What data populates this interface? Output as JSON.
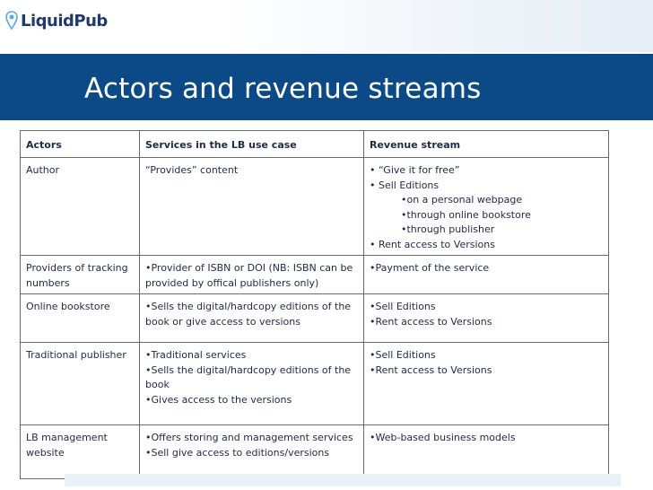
{
  "brand": {
    "name": "LiquidPub",
    "logo_icon": "location-pin-icon",
    "accent": "#0b4a86"
  },
  "title": "Actors and revenue streams",
  "table": {
    "headers": [
      "Actors",
      "Services in the LB use case",
      "Revenue stream"
    ],
    "rows": [
      {
        "actor": "Author",
        "services": [
          "“Provides” content"
        ],
        "revenue": [
          "• “Give it for free”",
          "• Sell Editions"
        ],
        "revenue_sub": [
          "•on a personal webpage",
          "•through online bookstore",
          "•through publisher"
        ],
        "revenue_after": [
          "• Rent access to Versions"
        ]
      },
      {
        "actor": "Providers of tracking numbers",
        "services": [
          "•Provider of ISBN or DOI (NB: ISBN can be provided by offical publishers only)"
        ],
        "revenue": [
          "•Payment of the service"
        ]
      },
      {
        "actor": "Online bookstore",
        "services": [
          "•Sells the digital/hardcopy editions of the book or give access to versions"
        ],
        "revenue": [
          "•Sell Editions",
          "•Rent access to Versions"
        ]
      },
      {
        "actor": "Traditional publisher",
        "services": [
          "•Traditional services",
          "•Sells the digital/hardcopy editions of the book",
          "•Gives access to the versions"
        ],
        "revenue": [
          "•Sell Editions",
          "•Rent access to Versions"
        ]
      },
      {
        "actor": "LB management website",
        "services": [
          "•Offers storing and management services",
          "•Sell give access to editions/versions"
        ],
        "revenue": [
          "•Web-based business models"
        ]
      }
    ]
  }
}
